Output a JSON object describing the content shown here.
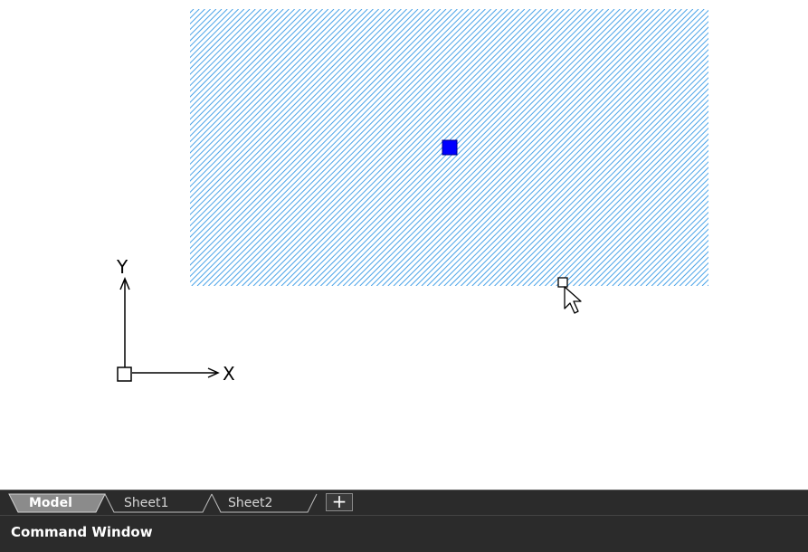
{
  "canvas": {
    "hatch_color": "#4aa3e8",
    "grip_color": "#0000ff",
    "ucs": {
      "x_label": "X",
      "y_label": "Y"
    }
  },
  "layout_tabs": {
    "items": [
      {
        "label": "Model",
        "active": true
      },
      {
        "label": "Sheet1",
        "active": false
      },
      {
        "label": "Sheet2",
        "active": false
      }
    ],
    "add_button_label": "+"
  },
  "command_window": {
    "title": "Command Window"
  }
}
